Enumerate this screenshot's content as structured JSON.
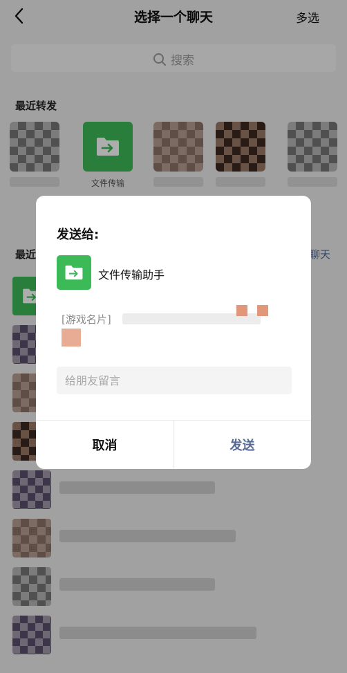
{
  "header": {
    "title": "选择一个聊天",
    "multi_select": "多选"
  },
  "search": {
    "placeholder": "搜索"
  },
  "recent_forward": {
    "title": "最近转发",
    "file_helper_label": "文件传输"
  },
  "recent_chats": {
    "title": "最近",
    "create_chat_fragment": "聊天"
  },
  "dialog": {
    "title": "发送给:",
    "target_name": "文件传输助手",
    "card_prefix": "[游戏名片]",
    "message_placeholder": "给朋友留言",
    "cancel_label": "取消",
    "send_label": "发送"
  },
  "colors": {
    "file_helper_green": "#3dba58",
    "send_blue": "#576b95"
  }
}
